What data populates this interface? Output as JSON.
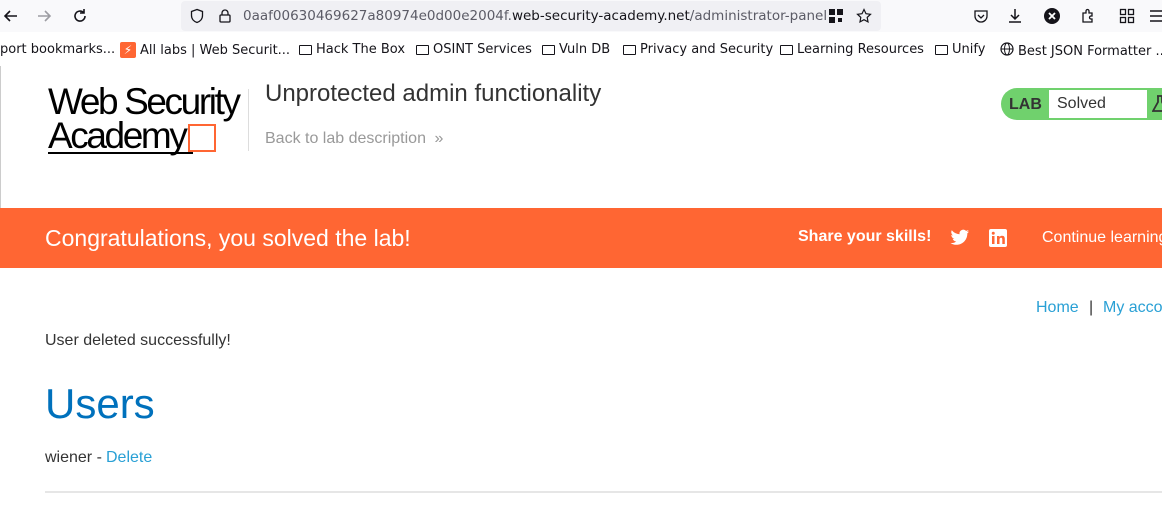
{
  "browser": {
    "url_prefix": "0aaf00630469627a80974e0d00e2004f.",
    "url_host": "web-security-academy.net",
    "url_path": "/administrator-panel",
    "bookmarks": [
      {
        "label": "port bookmarks...",
        "icon": "none"
      },
      {
        "label": "All labs | Web Securit...",
        "icon": "portswigger-icon"
      },
      {
        "label": "Hack The Box",
        "icon": "folder-icon"
      },
      {
        "label": "OSINT Services",
        "icon": "folder-icon"
      },
      {
        "label": "Vuln DB",
        "icon": "folder-icon"
      },
      {
        "label": "Privacy and Security",
        "icon": "folder-icon"
      },
      {
        "label": "Learning Resources",
        "icon": "folder-icon"
      },
      {
        "label": "Unify",
        "icon": "folder-icon"
      },
      {
        "label": "Best JSON Formatter ...",
        "icon": "globe-icon"
      }
    ]
  },
  "header": {
    "logo_line1": "Web Security",
    "logo_line2": "Academy",
    "lab_title": "Unprotected admin functionality",
    "back_link": "Back to lab description",
    "lab_badge": "LAB",
    "lab_status": "Solved"
  },
  "banner": {
    "message": "Congratulations, you solved the lab!",
    "share": "Share your skills!",
    "continue": "Continue learning"
  },
  "nav": {
    "home": "Home",
    "separator": "|",
    "account": "My account"
  },
  "content": {
    "message": "User deleted successfully!",
    "heading": "Users",
    "user": "wiener",
    "dash": "-",
    "delete": "Delete"
  },
  "colors": {
    "accent_orange": "#ff6633",
    "lab_green": "#70d16d",
    "link_blue": "#29a0d5",
    "heading_blue": "#0071bc"
  }
}
